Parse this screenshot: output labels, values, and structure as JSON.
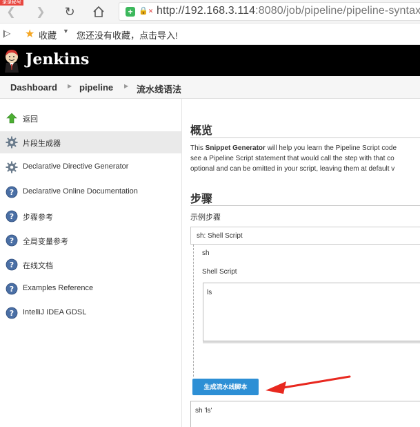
{
  "browser": {
    "corner_badge": "录录秘号",
    "url_host": "http://192.168.3.114",
    "url_rest": ":8080/job/pipeline/pipeline-syntax/"
  },
  "bookmarks": {
    "label": "收藏",
    "empty_text": "您还没有收藏，点击导入!"
  },
  "header": {
    "brand": "Jenkins"
  },
  "breadcrumb": [
    {
      "label": "Dashboard"
    },
    {
      "label": "pipeline"
    },
    {
      "label": "流水线语法"
    }
  ],
  "sidebar": {
    "items": [
      {
        "label": "返回",
        "icon": "up-arrow-icon"
      },
      {
        "label": "片段生成器",
        "icon": "gear-icon",
        "active": true
      },
      {
        "label": "Declarative Directive Generator",
        "icon": "gear-icon"
      },
      {
        "label": "Declarative Online Documentation",
        "icon": "help-icon"
      },
      {
        "label": "步骤参考",
        "icon": "help-icon"
      },
      {
        "label": "全局变量参考",
        "icon": "help-icon"
      },
      {
        "label": "在线文档",
        "icon": "help-icon"
      },
      {
        "label": "Examples Reference",
        "icon": "help-icon"
      },
      {
        "label": "IntelliJ IDEA GDSL",
        "icon": "help-icon"
      }
    ]
  },
  "main": {
    "overview_heading": "概览",
    "intro_line1_pre": "This ",
    "intro_line1_bold": "Snippet Generator",
    "intro_line1_post": " will help you learn the Pipeline Script code",
    "intro_line2": "see a Pipeline Script statement that would call the step with that co",
    "intro_line3": "optional and can be omitted in your script, leaving them at default v",
    "steps_heading": "步骤",
    "sample_step_label": "示例步骤",
    "selected_step": "sh: Shell Script",
    "step_name": "sh",
    "shell_script_label": "Shell Script",
    "script_value": "ls",
    "generate_button": "生成流水线脚本",
    "output_value": "sh 'ls'"
  },
  "colors": {
    "header_bg": "#000000",
    "button_bg": "#2d8fd5",
    "annotation_arrow": "#e8281f"
  }
}
